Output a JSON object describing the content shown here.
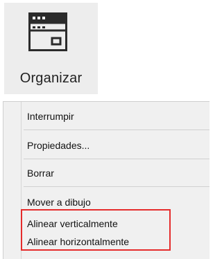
{
  "ribbon": {
    "button_label": "Organizar",
    "icon": "window-arrange-icon"
  },
  "context_menu": {
    "items": [
      {
        "label": "Interrumpir"
      },
      {
        "label": "Propiedades..."
      },
      {
        "label": "Borrar"
      },
      {
        "label": "Mover a dibujo"
      },
      {
        "label": "Alinear verticalmente"
      },
      {
        "label": "Alinear horizontalmente"
      }
    ],
    "highlight_color": "#e52b2b"
  }
}
